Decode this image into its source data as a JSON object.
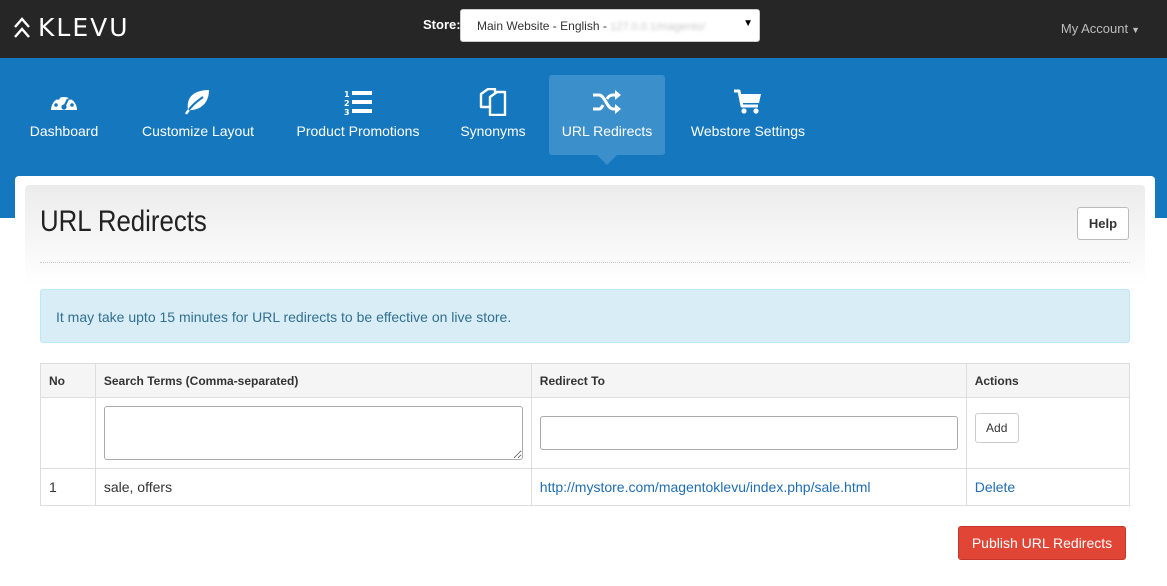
{
  "brand": {
    "logo_text": "KLEVU"
  },
  "store": {
    "label": "Store:",
    "selected_name": "Main Website - English - ",
    "selected_host": "127.0.0.1/magento/",
    "caret": "▼"
  },
  "account": {
    "label": "My Account",
    "caret": "▼"
  },
  "nav": {
    "items": [
      {
        "label": "Dashboard",
        "icon": "dashboard-icon"
      },
      {
        "label": "Customize Layout",
        "icon": "leaf-icon"
      },
      {
        "label": "Product Promotions",
        "icon": "ordered-list-icon"
      },
      {
        "label": "Synonyms",
        "icon": "copy-icon"
      },
      {
        "label": "URL Redirects",
        "icon": "shuffle-icon",
        "active": true
      },
      {
        "label": "Webstore Settings",
        "icon": "cart-icon"
      }
    ]
  },
  "page": {
    "title": "URL Redirects",
    "help_label": "Help",
    "info_message": "It may take upto 15 minutes for URL redirects to be effective on live store."
  },
  "table": {
    "headers": {
      "no": "No",
      "terms": "Search Terms (Comma-separated)",
      "redirect": "Redirect To",
      "actions": "Actions"
    },
    "new_row": {
      "terms_value": "",
      "redirect_value": "",
      "add_label": "Add"
    },
    "rows": [
      {
        "no": "1",
        "terms": "sale, offers",
        "redirect": "http://mystore.com/magentoklevu/index.php/sale.html",
        "action": "Delete"
      }
    ]
  },
  "publish_label": "Publish URL Redirects",
  "colors": {
    "topbar": "#262626",
    "nav": "#1577bd",
    "nav_active": "#3b8fcb",
    "alert_bg": "#d9edf7",
    "link": "#1f6db4",
    "publish": "#e14535"
  }
}
